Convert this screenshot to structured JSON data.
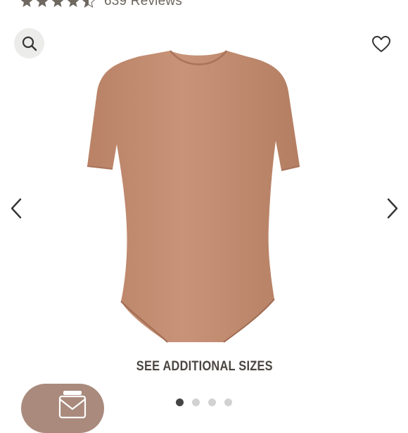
{
  "rating": {
    "stars": 4.5,
    "reviews_label": "639 Reviews"
  },
  "icons": {
    "zoom": "search-icon",
    "wishlist": "heart-icon",
    "prev": "chevron-left-icon",
    "next": "chevron-right-icon",
    "chat": "message-icon"
  },
  "banner": {
    "label": "SEE ADDITIONAL SIZES"
  },
  "carousel": {
    "total_slides": 4,
    "active_slide": 1
  },
  "colors": {
    "product": "#c08b6e",
    "star": "#6e6860",
    "chat_button": "#a98a7c",
    "active_dot": "#444444",
    "inactive_dot": "#d2d2d2"
  }
}
